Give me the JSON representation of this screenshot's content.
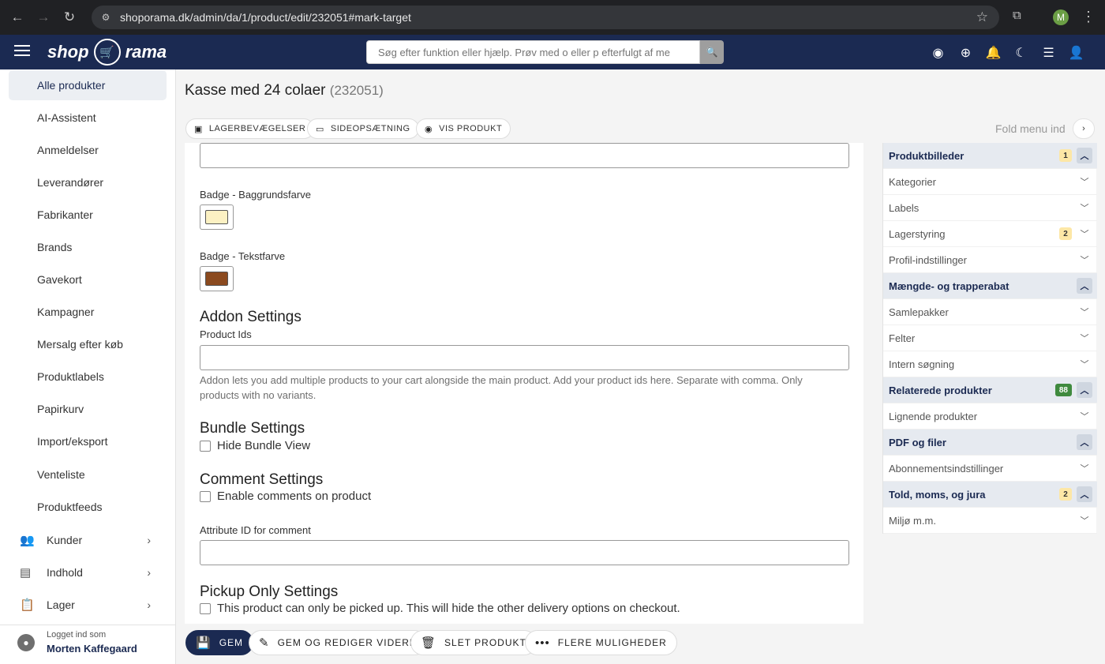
{
  "browser": {
    "url": "shoporama.dk/admin/da/1/product/edit/232051#mark-target",
    "profile_initial": "M"
  },
  "header": {
    "logo_left": "shop",
    "logo_right": "rama",
    "search_placeholder": "Søg efter funktion eller hjælp. Prøv med o eller p efterfulgt af me"
  },
  "sidebar": {
    "items": [
      {
        "label": "Alle produkter"
      },
      {
        "label": "AI-Assistent"
      },
      {
        "label": "Anmeldelser"
      },
      {
        "label": "Leverandører"
      },
      {
        "label": "Fabrikanter"
      },
      {
        "label": "Brands"
      },
      {
        "label": "Gavekort"
      },
      {
        "label": "Kampagner"
      },
      {
        "label": "Mersalg efter køb"
      },
      {
        "label": "Produktlabels"
      },
      {
        "label": "Papirkurv"
      },
      {
        "label": "Import/eksport"
      },
      {
        "label": "Venteliste"
      },
      {
        "label": "Produktfeeds"
      }
    ],
    "groups": [
      {
        "label": "Kunder",
        "icon": "people-icon"
      },
      {
        "label": "Indhold",
        "icon": "document-icon"
      },
      {
        "label": "Lager",
        "icon": "clipboard-icon"
      }
    ],
    "footer": {
      "logged_in_label": "Logget ind som",
      "user_name": "Morten Kaffegaard"
    }
  },
  "page": {
    "title": "Kasse med 24 colaer",
    "product_id": "(232051)",
    "chips": [
      {
        "label": "LAGERBEVÆGELSER",
        "icon": "archive-icon"
      },
      {
        "label": "SIDEOPSÆTNING",
        "icon": "layout-icon"
      },
      {
        "label": "VIS PRODUKT",
        "icon": "eye-icon"
      }
    ],
    "fold_menu": "Fold menu ind"
  },
  "form": {
    "badge_bg_label": "Badge - Baggrundsfarve",
    "badge_bg_color": "#fcf1c3",
    "badge_text_label": "Badge - Tekstfarve",
    "badge_text_color": "#8b4a1f",
    "addon_title": "Addon Settings",
    "product_ids_label": "Product Ids",
    "addon_help": "Addon lets you add multiple products to your cart alongside the main product. Add your product ids here. Separate with comma. Only products with no variants.",
    "bundle_title": "Bundle Settings",
    "hide_bundle_label": "Hide Bundle View",
    "comment_title": "Comment Settings",
    "enable_comments_label": "Enable comments on product",
    "attribute_id_label": "Attribute ID for comment",
    "pickup_title": "Pickup Only Settings",
    "pickup_label": "This product can only be picked up. This will hide the other delivery options on checkout."
  },
  "right_panel": {
    "rows": [
      {
        "label": "Produktbilleder",
        "highlight": true,
        "badge": "1",
        "badge_color": "amber",
        "chev": "up"
      },
      {
        "label": "Kategorier",
        "highlight": false,
        "chev": "down"
      },
      {
        "label": "Labels",
        "highlight": false,
        "chev": "down"
      },
      {
        "label": "Lagerstyring",
        "highlight": false,
        "badge": "2",
        "badge_color": "amber",
        "chev": "down"
      },
      {
        "label": "Profil-indstillinger",
        "highlight": false,
        "chev": "down"
      },
      {
        "label": "Mængde- og trapperabat",
        "highlight": true,
        "chev": "up"
      },
      {
        "label": "Samlepakker",
        "highlight": false,
        "chev": "down"
      },
      {
        "label": "Felter",
        "highlight": false,
        "chev": "down"
      },
      {
        "label": "Intern søgning",
        "highlight": false,
        "chev": "down"
      },
      {
        "label": "Relaterede produkter",
        "highlight": true,
        "badge": "88",
        "badge_color": "green",
        "chev": "up"
      },
      {
        "label": "Lignende produkter",
        "highlight": false,
        "chev": "down"
      },
      {
        "label": "PDF og filer",
        "highlight": true,
        "chev": "up"
      },
      {
        "label": "Abonnementsindstillinger",
        "highlight": false,
        "chev": "down"
      },
      {
        "label": "Told, moms, og jura",
        "highlight": true,
        "badge": "2",
        "badge_color": "amber",
        "chev": "up"
      },
      {
        "label": "Miljø m.m.",
        "highlight": false,
        "chev": "down"
      }
    ]
  },
  "actions": [
    {
      "label": "GEM",
      "icon": "save-icon",
      "primary": true
    },
    {
      "label": "GEM OG REDIGER VIDERE",
      "icon": "pencil-icon",
      "primary": false
    },
    {
      "label": "SLET PRODUKT",
      "icon": "trash-icon",
      "primary": false
    },
    {
      "label": "FLERE MULIGHEDER",
      "icon": "more-icon",
      "primary": false
    }
  ]
}
